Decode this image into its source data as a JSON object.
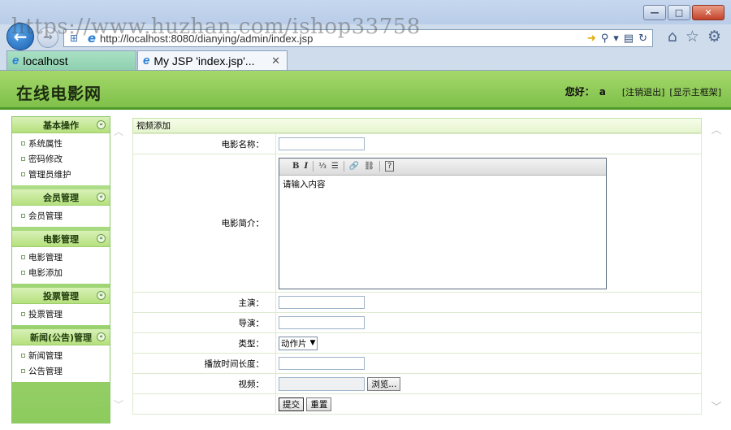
{
  "browser": {
    "url": "http://localhost:8080/dianying/admin/index.jsp",
    "watermark": "https://www.huzhan.com/ishop33758",
    "window_buttons": {
      "minimize": "—",
      "maximize": "□",
      "close": "✕"
    },
    "tabs": [
      {
        "label": "localhost"
      },
      {
        "label": "My JSP 'index.jsp'..."
      }
    ],
    "tab_close": "✕"
  },
  "header": {
    "title": "在线电影网",
    "greeting_label": "您好：",
    "username": "a",
    "logout_link": "[注销退出]",
    "show_frame_link": "[显示主框架]"
  },
  "sidebar": {
    "toggle_glyph": "«",
    "groups": [
      {
        "title": "基本操作",
        "items": [
          "系统属性",
          "密码修改",
          "管理员维护"
        ]
      },
      {
        "title": "会员管理",
        "items": [
          "会员管理"
        ]
      },
      {
        "title": "电影管理",
        "items": [
          "电影管理",
          "电影添加"
        ]
      },
      {
        "title": "投票管理",
        "items": [
          "投票管理"
        ]
      },
      {
        "title": "新闻(公告)管理",
        "items": [
          "新闻管理",
          "公告管理"
        ]
      }
    ]
  },
  "form": {
    "panel_title": "视频添加",
    "labels": {
      "name": "电影名称：",
      "intro": "电影简介：",
      "actor": "主演：",
      "director": "导演：",
      "type": "类型：",
      "duration": "播放时间长度：",
      "video": "视频："
    },
    "values": {
      "name": "",
      "actor": "",
      "director": "",
      "duration": "",
      "video": ""
    },
    "editor": {
      "toolbar": {
        "bold": "B",
        "italic": "I",
        "ordered_list": "⅓",
        "unordered_list": "☰",
        "link": "🔗",
        "unlink": "⛓",
        "help": "?"
      },
      "content": "请输入内容"
    },
    "type_selected": "动作片",
    "browse_label": "浏览...",
    "submit_label": "提交",
    "reset_label": "重置"
  }
}
